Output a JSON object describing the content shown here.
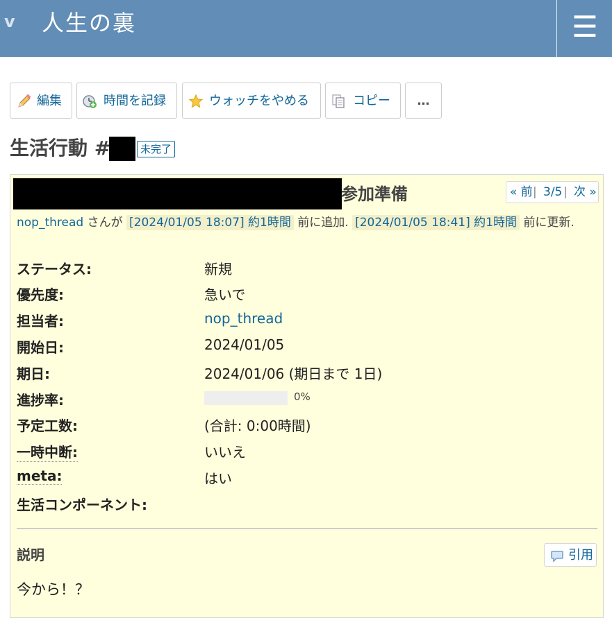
{
  "header": {
    "toggle_glyph": "v",
    "site_title": "人生の裏",
    "menu_glyph": "☰"
  },
  "toolbar": {
    "edit": "編集",
    "log_time": "時間を記録",
    "unwatch": "ウォッチをやめる",
    "copy": "コピー",
    "more": "…"
  },
  "issue": {
    "title_prefix": "生活行動 #",
    "status_badge": "未完了",
    "subject": "参加準備",
    "author_link": "nop_thread",
    "author_suffix": "さんが",
    "added_ts": "[2024/01/05 18:07] 約1時間",
    "added_text": "前に追加.",
    "updated_ts": "[2024/01/05 18:41] 約1時間",
    "updated_text": "前に更新."
  },
  "pager": {
    "prev": "« 前",
    "sep": "|",
    "position": "3/5",
    "next": "次 »"
  },
  "attributes": [
    {
      "label": "ステータス:",
      "value": "新規"
    },
    {
      "label": "優先度:",
      "value": "急いで"
    },
    {
      "label": "担当者:",
      "value": "nop_thread"
    },
    {
      "label": "開始日:",
      "value": "2024/01/05"
    },
    {
      "label": "期日:",
      "value": "2024/01/06 (期日まで 1日)"
    },
    {
      "label": "進捗率:",
      "value": "0%",
      "progress": 0
    },
    {
      "label": "予定工数:",
      "value": "(合計: 0:00時間)"
    },
    {
      "label": "一時中断:",
      "value": "いいえ"
    },
    {
      "label": "meta:",
      "value": "はい"
    },
    {
      "label": "生活コンポーネント:",
      "value": ""
    }
  ],
  "description": {
    "heading": "説明",
    "quote_label": "引用",
    "text": "今から！？"
  },
  "colors": {
    "header_bg": "#628db6",
    "panel_bg": "#ffffdd",
    "link": "#116699"
  }
}
